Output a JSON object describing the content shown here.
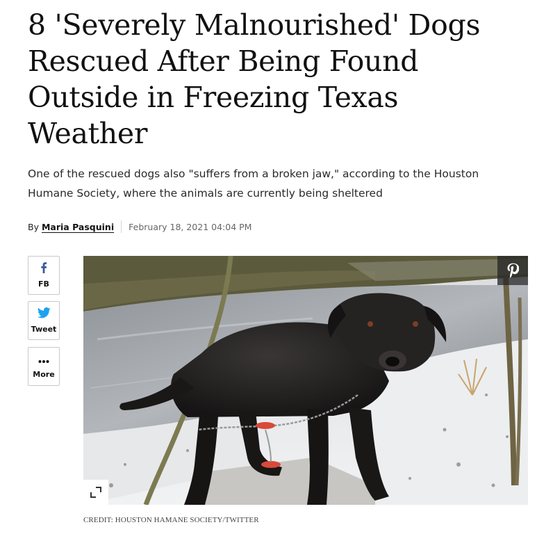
{
  "article": {
    "headline": "8 'Severely Malnourished' Dogs Rescued After Being Found Outside in Freezing Texas Weather",
    "dek": "One of the rescued dogs also \"suffers from a broken jaw,\" according to the Houston Humane Society, where the animals are currently being sheltered",
    "byline": {
      "prefix": "By",
      "author": "Maria Pasquini",
      "date": "February 18, 2021 04:04 PM"
    }
  },
  "share": {
    "facebook": {
      "label": "FB",
      "icon": "facebook-icon",
      "color": "#3b5998"
    },
    "twitter": {
      "label": "Tweet",
      "icon": "twitter-bird-icon",
      "color": "#1da1f2"
    },
    "more": {
      "label": "More",
      "icon": "ellipsis-icon"
    }
  },
  "photo": {
    "pin_icon": "pinterest-icon",
    "expand_icon": "expand-icon",
    "credit": "CREDIT: HOUSTON HAMANE SOCIETY/TWITTER"
  }
}
